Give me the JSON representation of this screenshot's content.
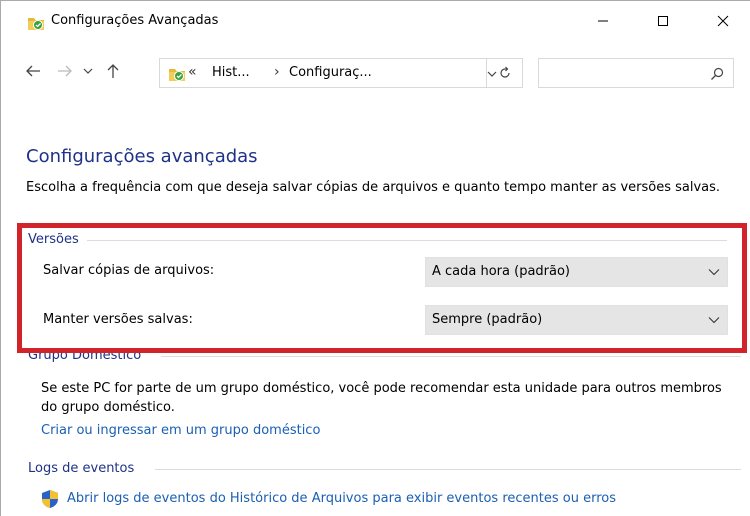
{
  "window": {
    "title": "Configurações Avançadas"
  },
  "address": {
    "overflow": "«",
    "crumbs": [
      "Hist...",
      "Configuraç..."
    ],
    "separator": "›"
  },
  "search": {
    "placeholder": ""
  },
  "page": {
    "title": "Configurações avançadas",
    "description": "Escolha a frequência com que deseja salvar cópias de arquivos e quanto tempo manter as versões salvas."
  },
  "versions": {
    "heading": "Versões",
    "save_label": "Salvar cópias de arquivos:",
    "save_value": "A cada hora (padrão)",
    "keep_label": "Manter versões salvas:",
    "keep_value": "Sempre (padrão)"
  },
  "homegroup": {
    "heading": "Grupo Doméstico",
    "text": "Se este PC for parte de um grupo doméstico, você pode recomendar esta unidade para outros membros do grupo doméstico.",
    "link": "Criar ou ingressar em um grupo doméstico"
  },
  "event_logs": {
    "heading": "Logs de eventos",
    "link": "Abrir logs de eventos do Histórico de Arquivos para exibir eventos recentes ou erros"
  },
  "colors": {
    "heading_blue": "#1e3287",
    "link_blue": "#1a5fb4",
    "highlight_red": "#d2232a"
  }
}
